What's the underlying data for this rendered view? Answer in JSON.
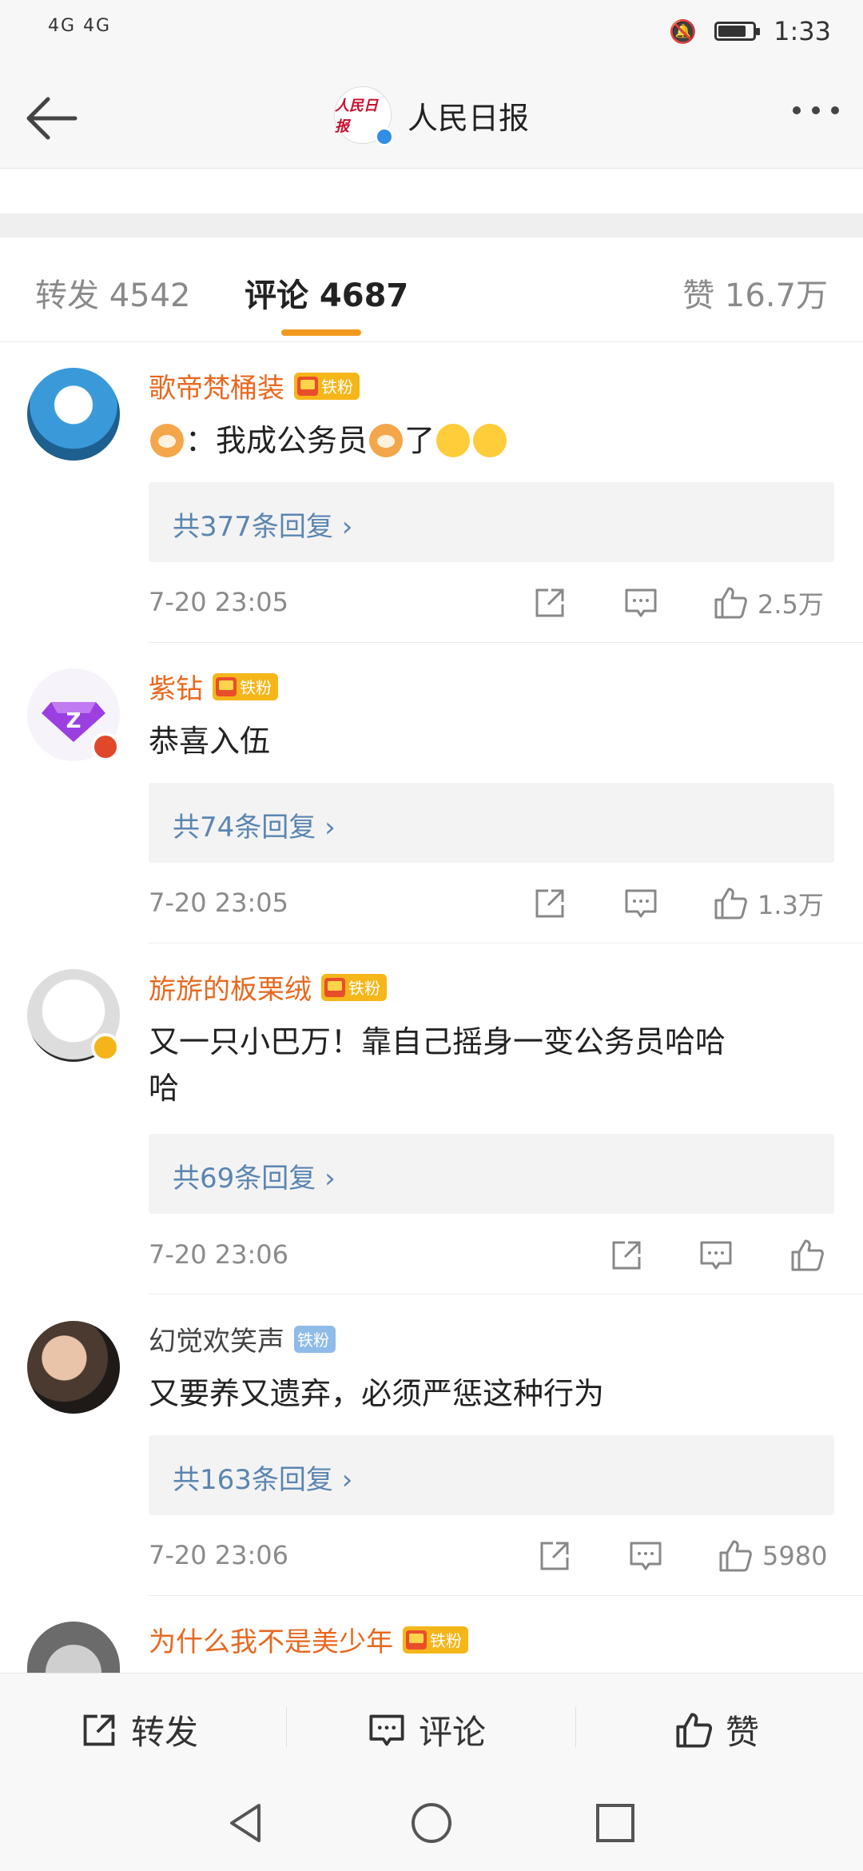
{
  "status_bar": {
    "signal_text": "4G 4G",
    "time": "1:33"
  },
  "header": {
    "title": "人民日报",
    "avatar_text": "人民日报"
  },
  "tabs": [
    {
      "label": "转发 4542",
      "active": false
    },
    {
      "label": "评论 4687",
      "active": true
    },
    {
      "label": "赞 16.7万",
      "active": false
    }
  ],
  "comments": [
    {
      "name": "歌帝梵桶装",
      "badge": "铁粉",
      "text_parts": [
        "：我成公务员",
        "了"
      ],
      "reply_label": "共377条回复 ›",
      "time": "7-20 23:05",
      "likes": "2.5万"
    },
    {
      "name": "紫钻",
      "badge": "铁粉",
      "text": "恭喜入伍",
      "reply_label": "共74条回复 ›",
      "time": "7-20 23:05",
      "likes": "1.3万"
    },
    {
      "name": "旂旂的板栗绒",
      "badge": "铁粉",
      "text_line1": "又一只小巴万！靠自己摇身一变公务员哈哈",
      "text_line2": "哈",
      "reply_label": "共69条回复 ›",
      "time": "7-20 23:06",
      "likes": ""
    },
    {
      "name": "幻觉欢笑声",
      "badge": "铁粉",
      "text": "又要养又遗弃，必须严惩这种行为",
      "reply_label": "共163条回复 ›",
      "time": "7-20 23:06",
      "likes": "5980"
    },
    {
      "name": "为什么我不是美少年",
      "badge": "铁粉"
    }
  ],
  "bottom_bar": {
    "repost": "转发",
    "comment": "评论",
    "like": "赞"
  },
  "colors": {
    "accent": "#f29a1f",
    "name_orange": "#e8681f",
    "link_blue": "#5b85b0",
    "meta_gray": "#8a8a8a"
  }
}
